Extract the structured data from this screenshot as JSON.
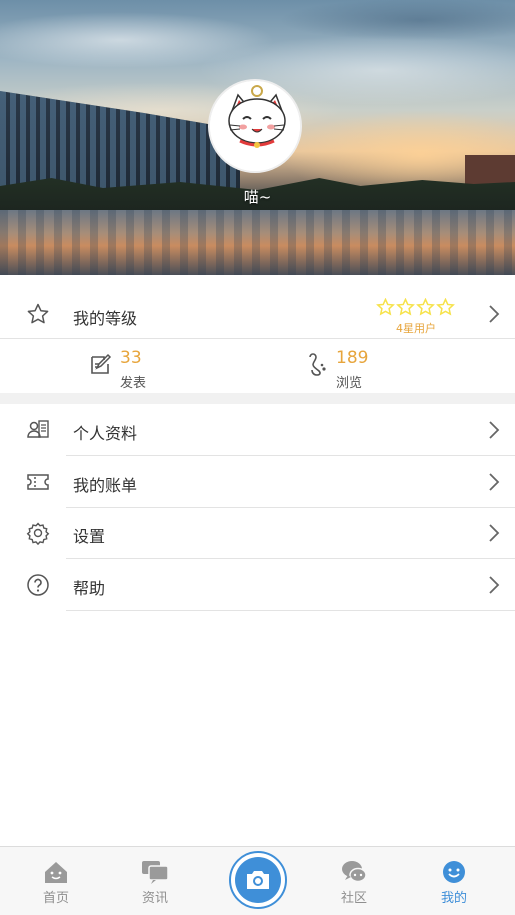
{
  "profile": {
    "nickname": "喵~",
    "avatar_text": "招财猫"
  },
  "level": {
    "label": "我的等级",
    "stars": 4,
    "star_max": 4,
    "rank_text": "4星用户",
    "star_color": "#f6e24a"
  },
  "stats": [
    {
      "value": "33",
      "label": "发表",
      "icon": "post-edit-icon"
    },
    {
      "value": "189",
      "label": "浏览",
      "icon": "footprint-icon"
    }
  ],
  "menu": [
    {
      "label": "个人资料",
      "icon": "profile-card-icon"
    },
    {
      "label": "我的账单",
      "icon": "ticket-icon"
    },
    {
      "label": "设置",
      "icon": "gear-icon"
    },
    {
      "label": "帮助",
      "icon": "help-icon"
    }
  ],
  "tabs": [
    {
      "label": "首页",
      "icon": "home-icon",
      "active": false
    },
    {
      "label": "资讯",
      "icon": "chat-icon",
      "active": false
    },
    {
      "label": "",
      "icon": "camera-icon",
      "active": false
    },
    {
      "label": "社区",
      "icon": "community-icon",
      "active": false
    },
    {
      "label": "我的",
      "icon": "smile-icon",
      "active": true
    }
  ],
  "colors": {
    "accent": "#3f8fd8",
    "highlight": "#e7a53c",
    "inactive_tab": "#8f8f8f"
  }
}
